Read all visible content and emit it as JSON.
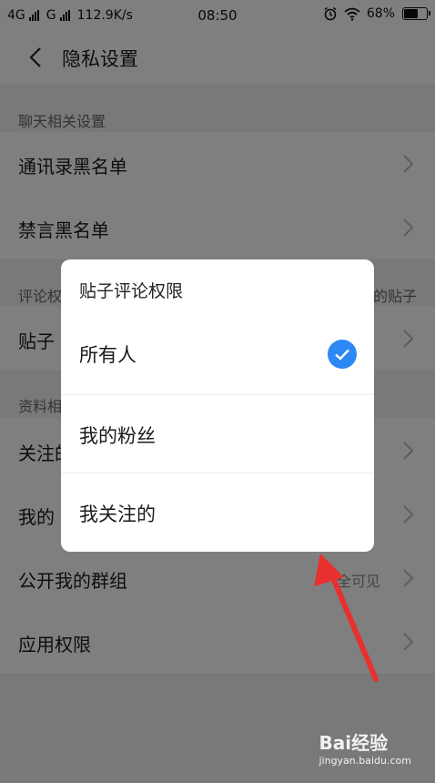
{
  "status_bar": {
    "network1": "4G",
    "network2": "G",
    "speed": "112.9K/s",
    "time": "08:50",
    "battery": "68%",
    "battery_level": 0.68
  },
  "header": {
    "title": "隐私设置"
  },
  "sections": {
    "chat": "聊天相关设置",
    "comment_partial": "评论权",
    "comment_right_partial": "的贴子",
    "profile_partial": "资料相"
  },
  "rows": {
    "contact_blacklist": "通讯录黑名单",
    "mute_blacklist": "禁言黑名单",
    "post_comment_partial": "贴子",
    "follow_partial": "关注的",
    "my_partial": "我的",
    "public_groups": "公开我的群组",
    "public_groups_value": "全可见",
    "app_permissions": "应用权限"
  },
  "dialog": {
    "title": "贴子评论权限",
    "options": [
      {
        "label": "所有人",
        "selected": true
      },
      {
        "label": "我的粉丝",
        "selected": false
      },
      {
        "label": "我关注的",
        "selected": false
      }
    ]
  },
  "colors": {
    "accent": "#2c88f5",
    "arrow": "#e8302e"
  },
  "watermark": {
    "line1": "Bai经验",
    "line2": "jingyan.baidu.com"
  }
}
